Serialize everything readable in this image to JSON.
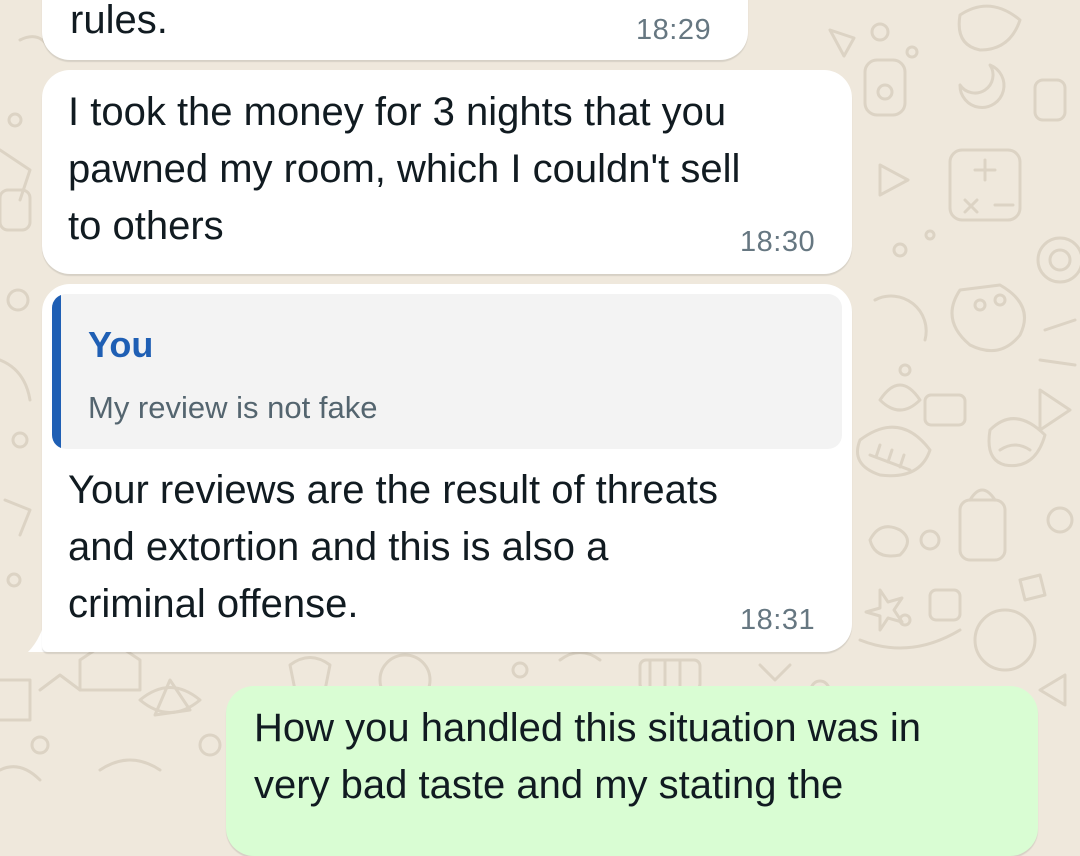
{
  "chat": {
    "messages": [
      {
        "direction": "incoming",
        "text": "rules.",
        "time": "18:29"
      },
      {
        "direction": "incoming",
        "text": "I took the money for 3 nights that you\npawned my room, which I couldn't sell\nto others",
        "time": "18:30"
      },
      {
        "direction": "incoming",
        "quote": {
          "author": "You",
          "text": "My review is not fake"
        },
        "text": "Your reviews are the result of threats\nand extortion and this is also a\ncriminal offense.",
        "time": "18:31"
      },
      {
        "direction": "outgoing",
        "text": "How you handled this situation was in\nvery bad taste and my stating the"
      }
    ]
  },
  "colors": {
    "wallpaper": "#efe8dc",
    "incoming_bubble": "#ffffff",
    "outgoing_bubble": "#d9fdd3",
    "quote_accent": "#1f5fb4",
    "timestamp": "#667781"
  }
}
